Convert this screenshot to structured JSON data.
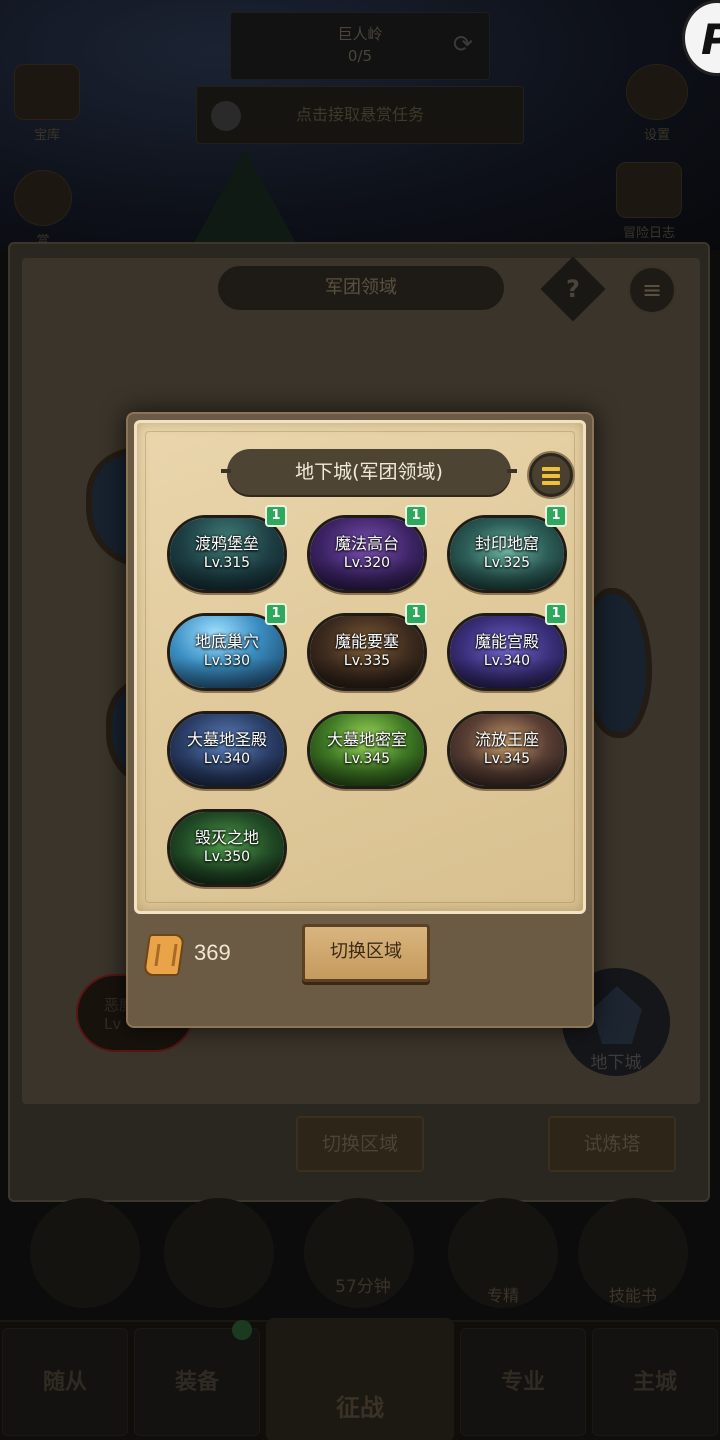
{
  "background": {
    "top_region": {
      "name": "巨人岭",
      "progress": "0/5"
    },
    "task_prompt": "点击接取悬赏任务",
    "side_left": [
      "宝库",
      "赏"
    ],
    "side_right": [
      "设置",
      "冒险日志"
    ],
    "realm_title": "军团领域",
    "help_label": "?",
    "city_label": "恶魔",
    "city_level_prefix": "Lv",
    "dungeon_entry_label": "地下城",
    "switch_area_label": "切换区域",
    "trial_tower_label": "试炼塔",
    "timer": "57分钟",
    "bottom_icons": [
      "专精",
      "技能书"
    ],
    "nav": [
      "随从",
      "装备",
      "征战",
      "专业",
      "主城"
    ]
  },
  "modal": {
    "title": "地下城(军团领域)",
    "menu_icon": "list-menu-icon",
    "dungeons": [
      {
        "name": "渡鸦堡垒",
        "level": "Lv.315",
        "badge": "1",
        "theme": "teal-stone"
      },
      {
        "name": "魔法高台",
        "level": "Lv.320",
        "badge": "1",
        "theme": "purple-arcane"
      },
      {
        "name": "封印地窟",
        "level": "Lv.325",
        "badge": "1",
        "theme": "teal-cave"
      },
      {
        "name": "地底巢穴",
        "level": "Lv.330",
        "badge": "1",
        "theme": "ice-blue"
      },
      {
        "name": "魔能要塞",
        "level": "Lv.335",
        "badge": "1",
        "theme": "dark-amber"
      },
      {
        "name": "魔能宫殿",
        "level": "Lv.340",
        "badge": "1",
        "theme": "violet-hall"
      },
      {
        "name": "大墓地圣殿",
        "level": "Lv.340",
        "badge": "",
        "theme": "blue-crypt"
      },
      {
        "name": "大墓地密室",
        "level": "Lv.345",
        "badge": "",
        "theme": "fel-green"
      },
      {
        "name": "流放王座",
        "level": "Lv.345",
        "badge": "",
        "theme": "amber-throne"
      },
      {
        "name": "毁灭之地",
        "level": "Lv.350",
        "badge": "",
        "theme": "green-ruin"
      }
    ],
    "currency": {
      "icon": "scroll-icon",
      "amount": "369"
    },
    "switch_button": "切换区域"
  }
}
